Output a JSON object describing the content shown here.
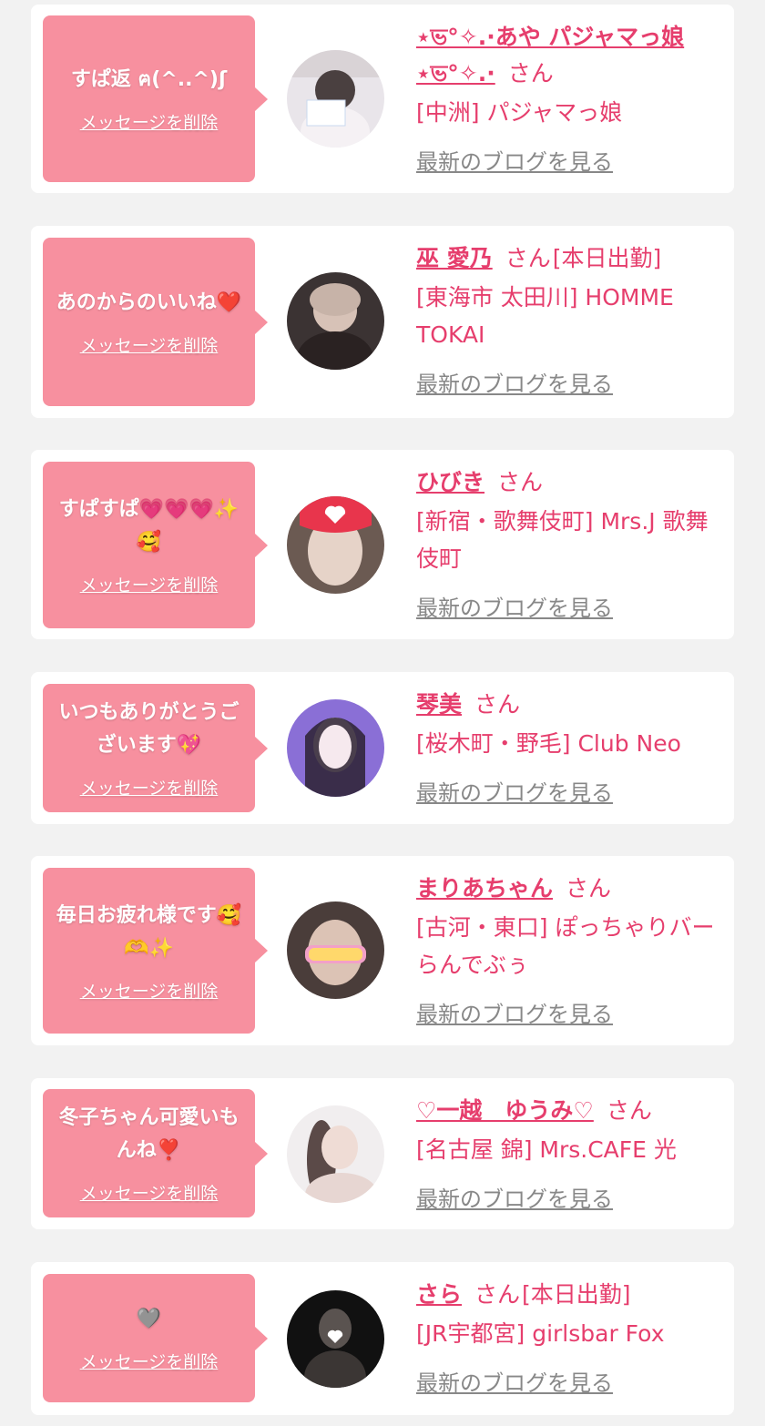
{
  "delete_label": "メッセージを削除",
  "san_label": "さん",
  "blog_label": "最新のブログを見る",
  "colors": {
    "background": "#f2f2f2",
    "card": "#ffffff",
    "bubble": "#f7909f",
    "accent": "#e63e6d",
    "link_gray": "#888888"
  },
  "items": [
    {
      "message": "すぱ返 ฅ(^..^)ʃ",
      "name": "⋆ভ°✧.·あや パジャマっ娘⋆ভ°✧.·",
      "work_status": "",
      "shop": "[中洲] パジャマっ娘",
      "avatar_icon": "profile-photo-icon"
    },
    {
      "message": "あのからのいいね❤️",
      "name": "巫 愛乃",
      "work_status": "[本日出勤]",
      "shop": "[東海市 太田川] HOMME TOKAI",
      "avatar_icon": "profile-photo-icon"
    },
    {
      "message": "すぱすぱ💗💗💗✨🥰",
      "name": "ひびき",
      "work_status": "",
      "shop": "[新宿・歌舞伎町] Mrs.J 歌舞伎町",
      "avatar_icon": "profile-photo-icon"
    },
    {
      "message": "いつもありがとうございます💖",
      "name": "琴美",
      "work_status": "",
      "shop": "[桜木町・野毛] Club Neo",
      "avatar_icon": "profile-photo-icon"
    },
    {
      "message": "毎日お疲れ様です🥰🫶✨",
      "name": "まりあちゃん",
      "work_status": "",
      "shop": "[古河・東口] ぽっちゃりバー らんでぶぅ",
      "avatar_icon": "profile-photo-icon"
    },
    {
      "message": "冬子ちゃん可愛いもんね❣️",
      "name": "♡一越　ゆうみ♡",
      "work_status": "",
      "shop": "[名古屋 錦] Mrs.CAFE 光",
      "avatar_icon": "profile-photo-icon"
    },
    {
      "message": "🩶",
      "name": "さら",
      "work_status": "[本日出勤]",
      "shop": "[JR宇都宮] girlsbar Fox",
      "avatar_icon": "profile-photo-icon"
    }
  ]
}
